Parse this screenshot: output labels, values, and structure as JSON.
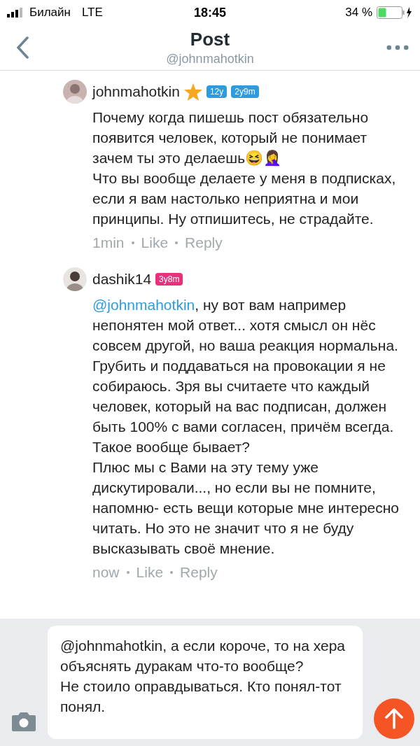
{
  "status_bar": {
    "carrier": "Билайн",
    "network": "LTE",
    "time": "18:45",
    "battery": "34 %"
  },
  "header": {
    "title": "Post",
    "subtitle": "@johnmahotkin"
  },
  "comments": [
    {
      "author": "johnmahotkin",
      "starred": true,
      "badges": [
        {
          "label": "12y",
          "color": "#2d9be0"
        },
        {
          "label": "2y9m",
          "color": "#2d9be0"
        }
      ],
      "body": "Почему когда пишешь пост обязательно появится человек, который не понимает зачем ты это делаешь😆🤦‍♀️\nЧто вы вообще делаете у меня в подписках, если я вам настолько неприятна и мои принципы. Ну отпишитесь, не страдайте.",
      "time": "1min",
      "like": "Like",
      "reply": "Reply"
    },
    {
      "author": "dashik14",
      "starred": false,
      "badges": [
        {
          "label": "3y8m",
          "color": "#e8317a"
        }
      ],
      "mention": "@johnmahotkin",
      "body": ", ну вот вам например непонятен мой ответ... хотя смысл он нёс совсем другой, но ваша реакция нормальна. Грубить и поддаваться на провокации я не собираюсь. Зря вы считаете что каждый человек, который на вас подписан, должен быть 100% с вами согласен, причём всегда. Такое вообще бывает?\nПлюс мы с Вами на эту тему уже дискутировали..., но если вы не помните, напомню- есть вещи которые мне интересно читать. Но это не значит что я не буду высказывать своё мнение.",
      "time": "now",
      "like": "Like",
      "reply": "Reply"
    }
  ],
  "composer": {
    "value": "@johnmahotkin, а если короче, то на хера объяснять дуракам что-то вообще?\nНе стоило оправдываться. Кто понял-тот понял."
  }
}
